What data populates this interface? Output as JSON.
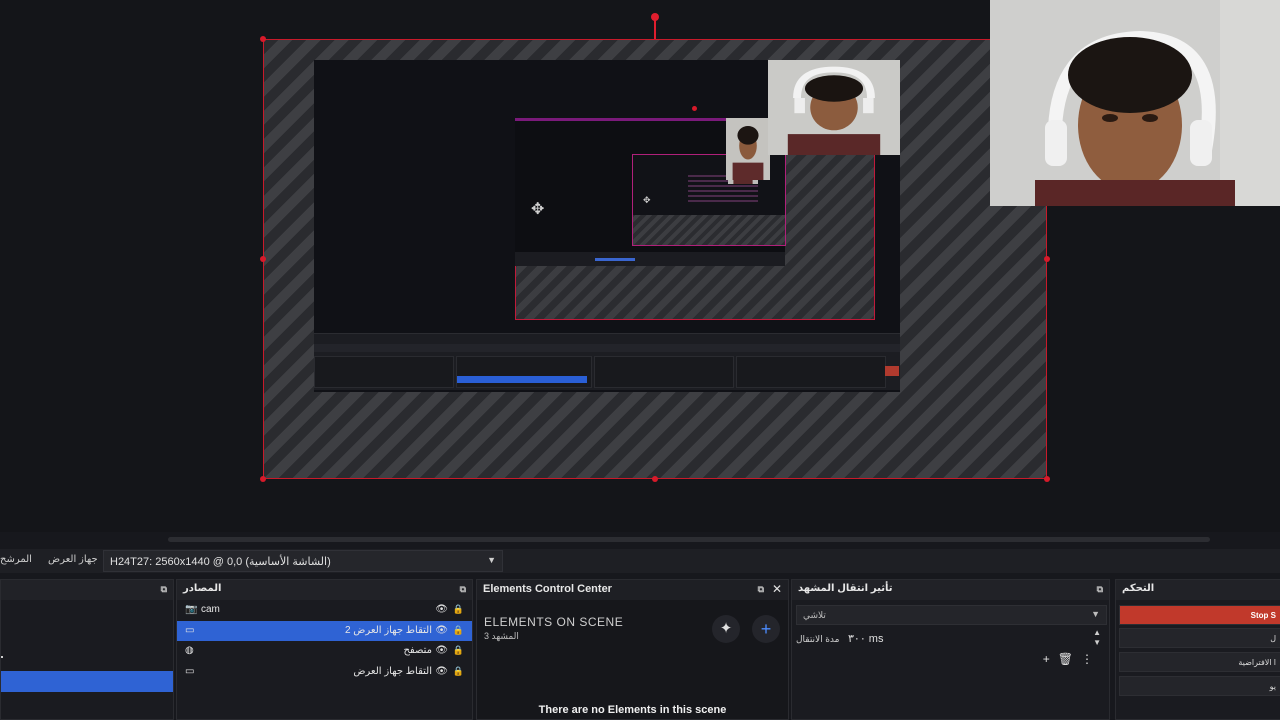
{
  "toolbar": {
    "preview_label": "المرشح",
    "device_label": "جهاز العرض",
    "display_value": "H24T27: 2560x1440 @ 0,0 (الشاشة الأساسية)"
  },
  "docks": {
    "sources": {
      "title": "المصادر",
      "items": [
        {
          "name": "cam",
          "icon": "camera-icon",
          "selected": false
        },
        {
          "name": "التقاط جهاز العرض 2",
          "icon": "monitor-icon",
          "selected": true
        },
        {
          "name": "متصفح",
          "icon": "globe-icon",
          "selected": false
        },
        {
          "name": "التقاط جهاز العرض",
          "icon": "monitor-icon",
          "selected": false
        }
      ]
    },
    "ecc": {
      "title": "Elements Control Center",
      "heading": "ELEMENTS ON SCENE",
      "subheading": "3 المشهد",
      "empty_message": "There are no Elements in this scene"
    },
    "transitions": {
      "title": "تأثير انتقال المشهد",
      "type_value": "تلاشي",
      "duration_label": "مدة الانتقال",
      "duration_value": "٣٠٠ ms"
    },
    "controls": {
      "title": "التحكم",
      "stop_label": "Stop S",
      "btn2_label": "ل",
      "btn3_label": "ا الافتراضية",
      "btn4_label": "يو"
    }
  },
  "colors": {
    "accent_blue": "#2f63d4",
    "selection_red": "#c81a2a",
    "stop_red": "#c1392b"
  }
}
